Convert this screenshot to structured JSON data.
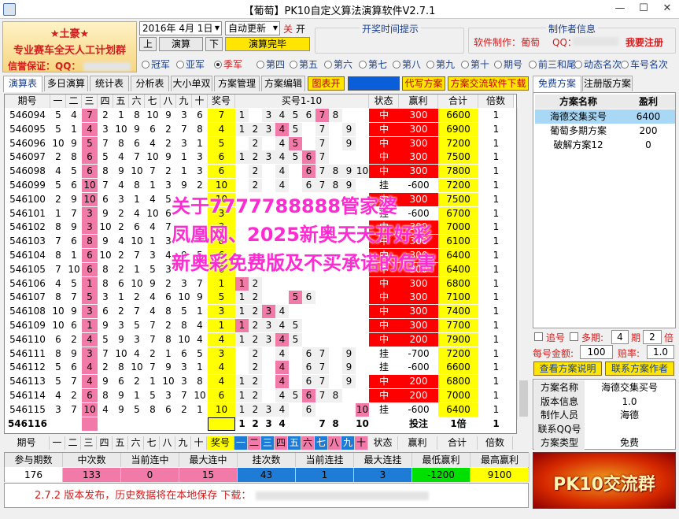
{
  "window": {
    "title": "【葡萄】PK10自定义算法演算软件V2.7.1",
    "minimize": "—",
    "maximize": "☐",
    "close": "✕"
  },
  "ad": {
    "line1": "★土豪★",
    "line2": "专业赛车全天人工计划群",
    "line3": "信誉保证：QQ："
  },
  "controls": {
    "date": "2016年 4月 1日",
    "update_mode": "自动更新",
    "btn_up": "上",
    "btn_calc": "演算",
    "btn_down": "下",
    "off_label": "关",
    "on_label": "开",
    "status": "演算完毕"
  },
  "draw_time": {
    "label": "开奖时间提示"
  },
  "author": {
    "label": "制作者信息",
    "software_by": "软件制作：葡萄",
    "qq_label": "QQ：",
    "register": "我要注册"
  },
  "radios": [
    {
      "label": "冠军",
      "on": false
    },
    {
      "label": "亚军",
      "on": false
    },
    {
      "label": "季军",
      "on": true
    },
    {
      "label": "第四",
      "on": false
    },
    {
      "label": "第五",
      "on": false
    },
    {
      "label": "第六",
      "on": false
    },
    {
      "label": "第七",
      "on": false
    },
    {
      "label": "第八",
      "on": false
    },
    {
      "label": "第九",
      "on": false
    },
    {
      "label": "第十",
      "on": false
    },
    {
      "label": "期号",
      "on": false
    },
    {
      "label": "前三和尾",
      "on": false
    },
    {
      "label": "动态名次",
      "on": false
    },
    {
      "label": "车号名次",
      "on": false
    }
  ],
  "tabs": [
    "演算表",
    "多日演算",
    "统计表",
    "分析表",
    "大小单双",
    "方案管理",
    "方案编辑"
  ],
  "toolbar": {
    "chart": "图表开",
    "rewrite": "代写方案",
    "download": "方案交流软件下载"
  },
  "side_tabs": [
    "免费方案",
    "注册版方案"
  ],
  "table": {
    "headers": {
      "period": "期号",
      "pos": [
        "一",
        "二",
        "三",
        "四",
        "五",
        "六",
        "七",
        "八",
        "九",
        "十"
      ],
      "prize": "奖号",
      "buy": "买号1-10",
      "status": "状态",
      "pnl": "赢利",
      "total": "合计",
      "mult": "倍数"
    },
    "rows": [
      {
        "p": "546094",
        "n": [
          5,
          4,
          7,
          2,
          1,
          8,
          10,
          9,
          3,
          6
        ],
        "z": "7",
        "b": [
          1,
          0,
          3,
          4,
          5,
          6,
          7,
          8,
          0,
          0
        ],
        "s": "中",
        "w": "300",
        "t": "6600",
        "m": "1"
      },
      {
        "p": "546095",
        "n": [
          5,
          1,
          4,
          3,
          10,
          9,
          6,
          2,
          7,
          8
        ],
        "z": "4",
        "b": [
          1,
          2,
          3,
          4,
          5,
          0,
          7,
          0,
          9,
          0
        ],
        "s": "中",
        "w": "300",
        "t": "6900",
        "m": "1"
      },
      {
        "p": "546096",
        "n": [
          10,
          9,
          5,
          7,
          8,
          6,
          4,
          2,
          3,
          1
        ],
        "z": "5",
        "b": [
          0,
          2,
          0,
          4,
          5,
          0,
          7,
          0,
          9,
          0
        ],
        "s": "中",
        "w": "300",
        "t": "7200",
        "m": "1"
      },
      {
        "p": "546097",
        "n": [
          2,
          8,
          6,
          5,
          4,
          7,
          10,
          9,
          1,
          3
        ],
        "z": "6",
        "b": [
          1,
          2,
          3,
          4,
          5,
          6,
          7,
          0,
          0,
          0
        ],
        "s": "中",
        "w": "300",
        "t": "7500",
        "m": "1"
      },
      {
        "p": "546098",
        "n": [
          4,
          5,
          6,
          8,
          9,
          10,
          7,
          2,
          1,
          3
        ],
        "z": "6",
        "b": [
          0,
          2,
          0,
          4,
          0,
          6,
          7,
          8,
          9,
          10
        ],
        "s": "中",
        "w": "300",
        "t": "7800",
        "m": "1"
      },
      {
        "p": "546099",
        "n": [
          5,
          6,
          10,
          7,
          4,
          8,
          1,
          3,
          9,
          2
        ],
        "z": "10",
        "b": [
          0,
          2,
          0,
          4,
          0,
          6,
          7,
          8,
          9,
          0
        ],
        "s": "挂",
        "w": "-600",
        "t": "7200",
        "m": "1"
      },
      {
        "p": "546100",
        "n": [
          2,
          9,
          10,
          6,
          3,
          1,
          4,
          5,
          0,
          0
        ],
        "z": "10",
        "b": [
          0,
          0,
          0,
          0,
          0,
          0,
          0,
          0,
          0,
          0
        ],
        "s": "中",
        "w": "300",
        "t": "7500",
        "m": "1"
      },
      {
        "p": "546101",
        "n": [
          1,
          7,
          3,
          9,
          2,
          4,
          10,
          6,
          0,
          0
        ],
        "z": "3",
        "b": [
          0,
          0,
          0,
          0,
          0,
          0,
          0,
          0,
          0,
          0
        ],
        "s": "挂",
        "w": "-600",
        "t": "6700",
        "m": "1"
      },
      {
        "p": "546102",
        "n": [
          8,
          9,
          3,
          10,
          2,
          6,
          4,
          7,
          0,
          0
        ],
        "z": "3",
        "b": [
          0,
          0,
          0,
          0,
          0,
          0,
          0,
          0,
          0,
          0
        ],
        "s": "中",
        "w": "300",
        "t": "7000",
        "m": "1"
      },
      {
        "p": "546103",
        "n": [
          7,
          6,
          8,
          9,
          4,
          10,
          1,
          3,
          0,
          0
        ],
        "z": "8",
        "b": [
          0,
          0,
          0,
          0,
          0,
          0,
          0,
          0,
          0,
          0
        ],
        "s": "中",
        "w": "300",
        "t": "6100",
        "m": "1"
      },
      {
        "p": "546104",
        "n": [
          8,
          1,
          6,
          10,
          2,
          7,
          3,
          4,
          9,
          5
        ],
        "z": "6",
        "b": [
          0,
          0,
          0,
          0,
          0,
          0,
          0,
          0,
          0,
          0
        ],
        "s": "中",
        "w": "300",
        "t": "6400",
        "m": "1"
      },
      {
        "p": "546105",
        "n": [
          7,
          10,
          6,
          8,
          2,
          1,
          5,
          3,
          0,
          0
        ],
        "z": "6",
        "b": [
          0,
          0,
          0,
          0,
          0,
          0,
          0,
          0,
          0,
          0
        ],
        "s": "中",
        "w": "300",
        "t": "6400",
        "m": "1"
      },
      {
        "p": "546106",
        "n": [
          4,
          5,
          1,
          8,
          6,
          10,
          9,
          2,
          3,
          7
        ],
        "z": "1",
        "b": [
          1,
          2,
          0,
          0,
          0,
          0,
          0,
          0,
          0,
          0
        ],
        "s": "中",
        "w": "300",
        "t": "6800",
        "m": "1"
      },
      {
        "p": "546107",
        "n": [
          8,
          7,
          5,
          3,
          1,
          2,
          4,
          6,
          10,
          9
        ],
        "z": "5",
        "b": [
          1,
          2,
          0,
          0,
          5,
          6,
          0,
          0,
          0,
          0
        ],
        "s": "中",
        "w": "300",
        "t": "7100",
        "m": "1"
      },
      {
        "p": "546108",
        "n": [
          10,
          9,
          3,
          6,
          2,
          7,
          4,
          8,
          5,
          1
        ],
        "z": "3",
        "b": [
          1,
          2,
          3,
          4,
          0,
          0,
          0,
          0,
          0,
          0
        ],
        "s": "中",
        "w": "300",
        "t": "7400",
        "m": "1"
      },
      {
        "p": "546109",
        "n": [
          10,
          6,
          1,
          9,
          3,
          5,
          7,
          2,
          8,
          4
        ],
        "z": "1",
        "b": [
          1,
          2,
          3,
          4,
          5,
          0,
          0,
          0,
          0,
          0
        ],
        "s": "中",
        "w": "300",
        "t": "7700",
        "m": "1"
      },
      {
        "p": "546110",
        "n": [
          6,
          2,
          4,
          5,
          9,
          3,
          7,
          8,
          10,
          4
        ],
        "z": "4",
        "b": [
          1,
          2,
          3,
          4,
          5,
          0,
          0,
          0,
          0,
          0
        ],
        "s": "中",
        "w": "200",
        "t": "7900",
        "m": "1"
      },
      {
        "p": "546111",
        "n": [
          8,
          9,
          3,
          7,
          10,
          4,
          2,
          1,
          6,
          5
        ],
        "z": "3",
        "b": [
          0,
          2,
          0,
          4,
          0,
          6,
          7,
          0,
          9,
          0
        ],
        "s": "挂",
        "w": "-700",
        "t": "7200",
        "m": "1"
      },
      {
        "p": "546112",
        "n": [
          5,
          6,
          4,
          2,
          8,
          10,
          7,
          9,
          3,
          1
        ],
        "z": "4",
        "b": [
          0,
          2,
          0,
          4,
          0,
          6,
          7,
          0,
          9,
          0
        ],
        "s": "挂",
        "w": "-600",
        "t": "6600",
        "m": "1"
      },
      {
        "p": "546113",
        "n": [
          5,
          7,
          4,
          9,
          6,
          2,
          1,
          10,
          3,
          8
        ],
        "z": "4",
        "b": [
          1,
          2,
          0,
          4,
          0,
          6,
          7,
          0,
          9,
          0
        ],
        "s": "中",
        "w": "200",
        "t": "6800",
        "m": "1"
      },
      {
        "p": "546114",
        "n": [
          4,
          2,
          6,
          8,
          9,
          1,
          5,
          3,
          7,
          10
        ],
        "z": "6",
        "b": [
          1,
          2,
          0,
          4,
          5,
          6,
          7,
          8,
          0,
          0
        ],
        "s": "中",
        "w": "200",
        "t": "7000",
        "m": "1"
      },
      {
        "p": "546115",
        "n": [
          3,
          7,
          10,
          4,
          9,
          5,
          8,
          6,
          2,
          1
        ],
        "z": "10",
        "b": [
          1,
          2,
          3,
          4,
          0,
          6,
          0,
          0,
          0,
          10
        ],
        "s": "挂",
        "w": "-600",
        "t": "6400",
        "m": "1"
      }
    ],
    "current": {
      "p": "546116",
      "z": "",
      "b": [
        "1",
        "2",
        "3",
        "4",
        "",
        "",
        "7",
        "8",
        "",
        "10"
      ],
      "s": "",
      "w": "投注",
      "t": "1倍",
      "m": "1"
    }
  },
  "footer_header": {
    "period": "期号",
    "pos": [
      "一",
      "二",
      "三",
      "四",
      "五",
      "六",
      "七",
      "八",
      "九",
      "十"
    ],
    "prize": "奖号",
    "nums": [
      "一",
      "二",
      "三",
      "四",
      "五",
      "六",
      "七",
      "八",
      "九",
      "十"
    ],
    "status": "状态",
    "pnl": "赢利",
    "total": "合计",
    "mult": "倍数"
  },
  "stats": {
    "labels": [
      "参与期数",
      "中次数",
      "当前连中",
      "最大连中",
      "挂次数",
      "当前连挂",
      "最大连挂",
      "最低赢利",
      "最高赢利"
    ],
    "values": [
      "176",
      "133",
      "0",
      "15",
      "43",
      "1",
      "3",
      "-1200",
      "9100"
    ]
  },
  "notice": "2.7.2 版本发布，历史数据将在本地保存 下载：",
  "schemes": {
    "headers": [
      "方案名称",
      "盈利"
    ],
    "rows": [
      [
        "海德交集买号",
        "6400"
      ],
      [
        "葡萄多期方案",
        "200"
      ],
      [
        "破解方案12",
        "0"
      ]
    ]
  },
  "options": {
    "chase": "追号",
    "multi": "多期:",
    "multi_val": "4",
    "period": "期",
    "period_val": "2",
    "mult": "倍",
    "bet_label": "每号金额:",
    "bet_val": "100",
    "odds_label": "赔率:",
    "odds_val": "1.0",
    "view_btn": "查看方案说明",
    "contact_btn": "联系方案作者"
  },
  "info": {
    "rows": [
      [
        "方案名称",
        "海德交集买号"
      ],
      [
        "版本信息",
        "1.0"
      ],
      [
        "制作人员",
        "海德"
      ],
      [
        "联系QQ号",
        ""
      ],
      [
        "方案类型",
        "免费"
      ]
    ]
  },
  "banner": "PK10交流群",
  "watermark": [
    "关于7777788888管家婆",
    "凤凰网、2025新奥天天开好彩",
    "新奥彩免费版及不买承诺的危害"
  ],
  "colors": {
    "hit": "#ff0000",
    "pink": "#f17aa8",
    "yellow": "#ffff00",
    "blue": "#1e7bd6",
    "green": "#00e000"
  }
}
